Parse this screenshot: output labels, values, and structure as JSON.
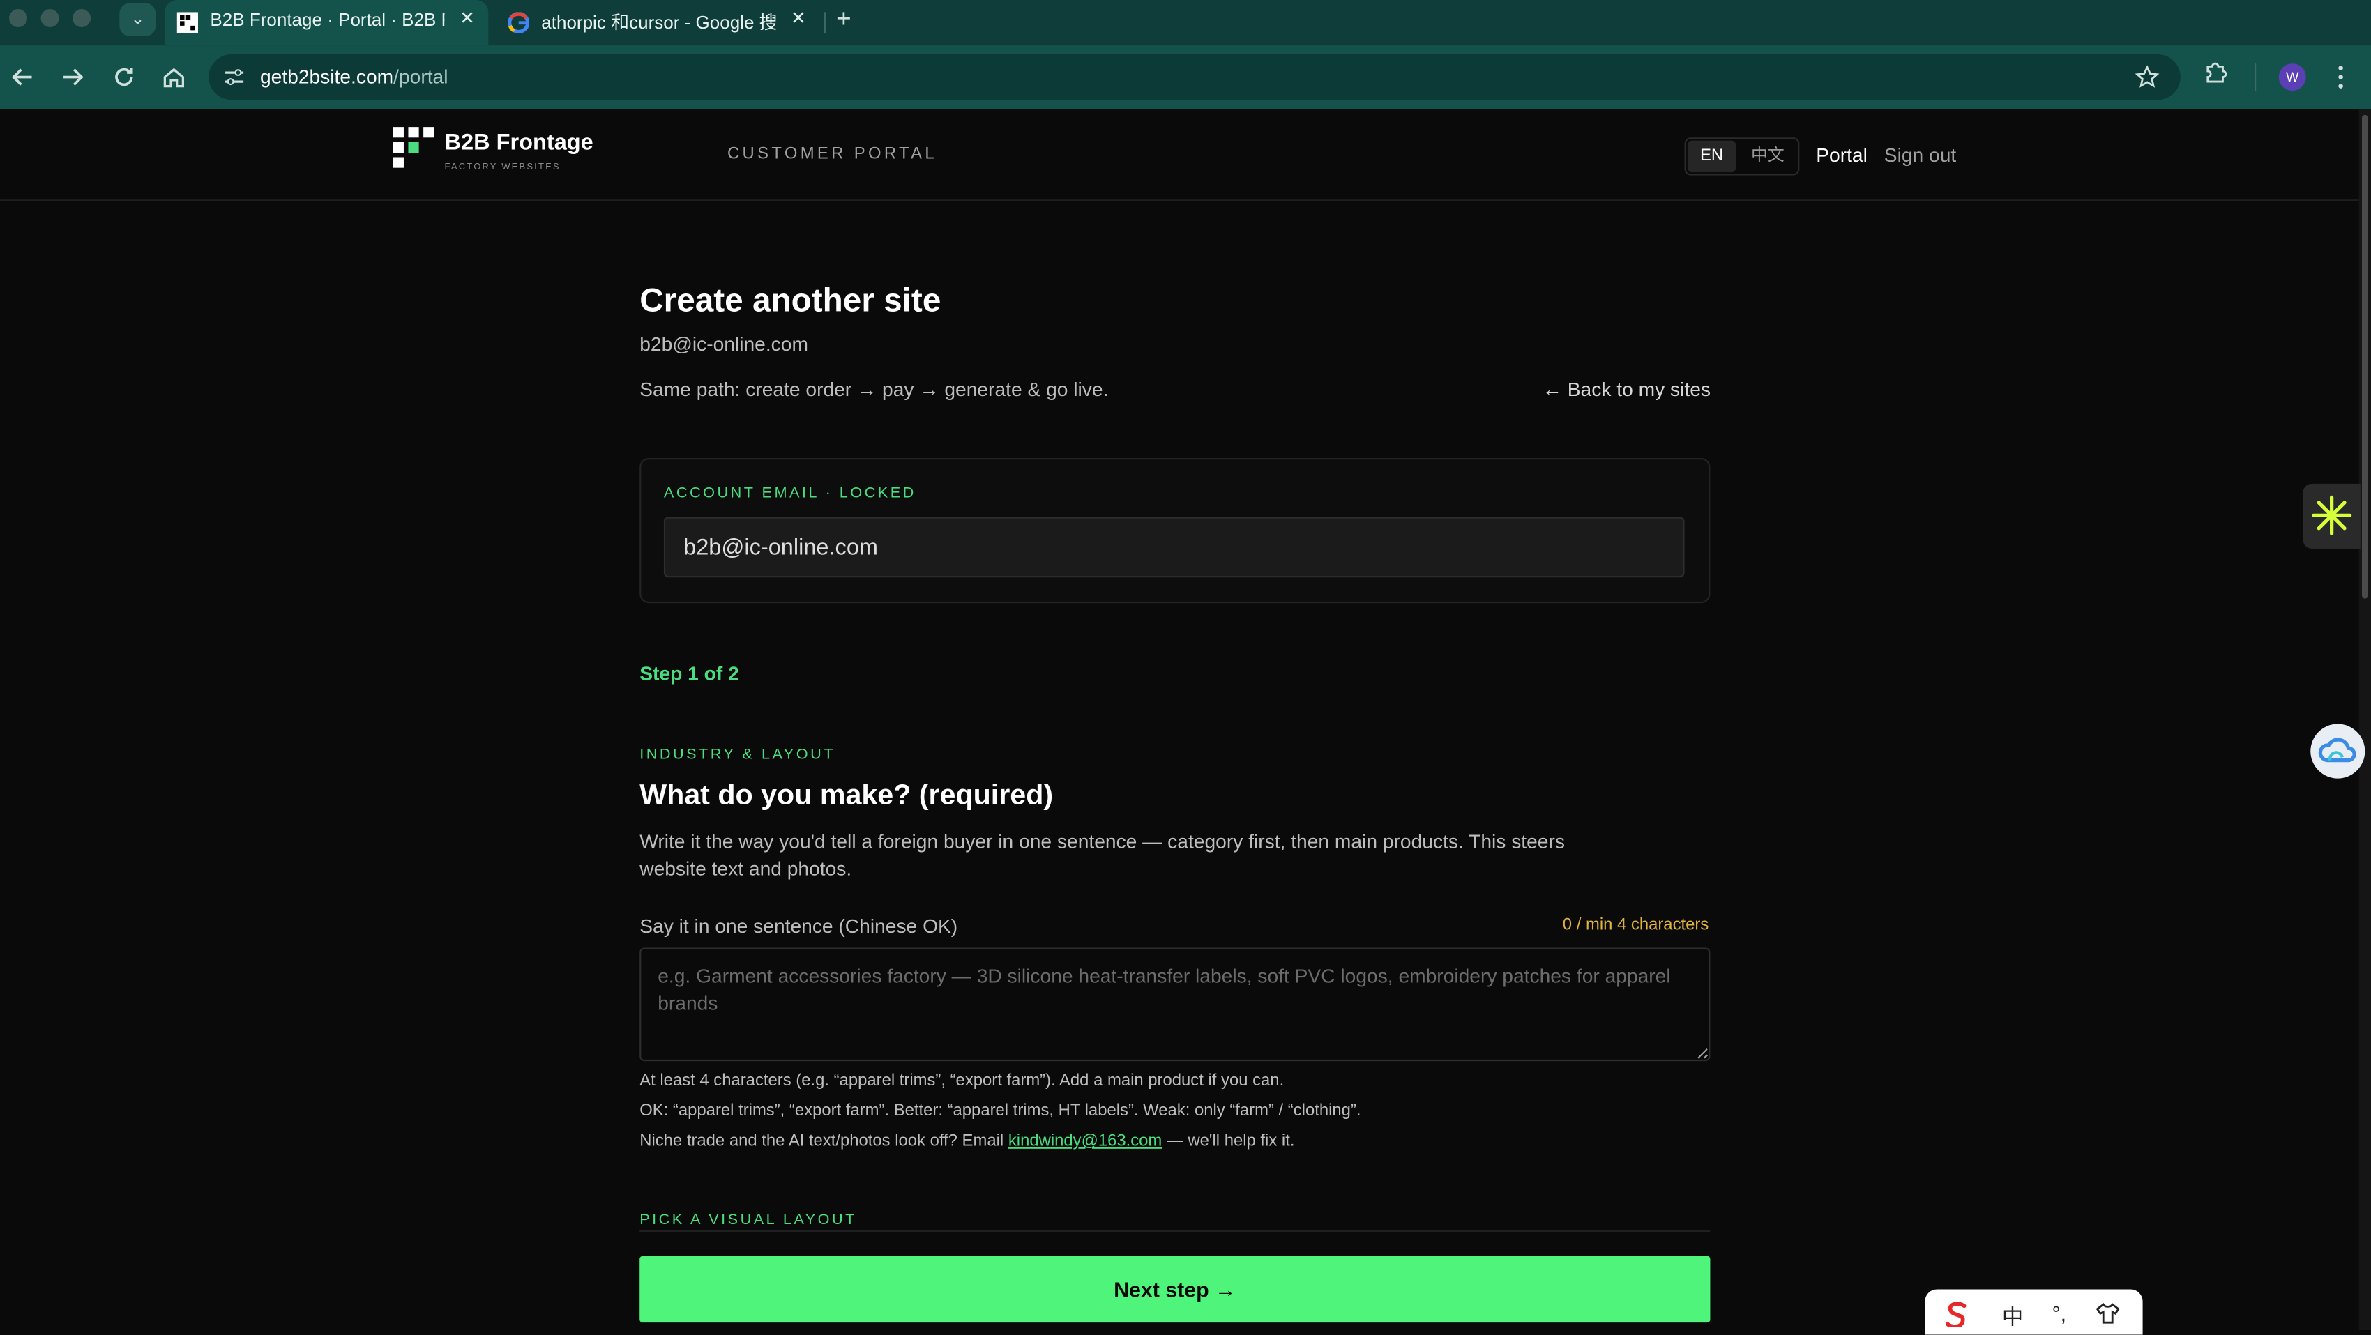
{
  "browser": {
    "tabs": [
      {
        "title": "B2B Frontage · Portal · B2B F",
        "active": true
      },
      {
        "title": "athorpic 和cursor - Google 搜",
        "active": false
      }
    ],
    "close_glyph": "✕",
    "new_tab_glyph": "+",
    "tabs_menu_glyph": "⌄",
    "url_host": "getb2bsite.com",
    "url_path": "/portal",
    "profile_initial": "W",
    "icons": [
      "back-icon",
      "forward-icon",
      "reload-icon",
      "home-icon",
      "site-settings-icon",
      "bookmark-star-icon",
      "extensions-icon",
      "menu-icon"
    ]
  },
  "header": {
    "brand": "B2B Frontage",
    "tagline": "FACTORY WEBSITES",
    "portal_label": "CUSTOMER PORTAL",
    "lang_en": "EN",
    "lang_zh": "中文",
    "nav_portal": "Portal",
    "nav_signout": "Sign out"
  },
  "main": {
    "title": "Create another site",
    "email": "b2b@ic-online.com",
    "path_text": "Same path: create order → pay → generate & go live.",
    "back_link": "← Back to my sites",
    "account_label": "ACCOUNT EMAIL · LOCKED",
    "account_value": "b2b@ic-online.com",
    "step": "Step 1 of 2",
    "section_label": "INDUSTRY & LAYOUT",
    "question": "What do you make? (required)",
    "help": "Write it the way you'd tell a foreign buyer in one sentence — category first, then main products. This steers website text and photos.",
    "field_label": "Say it in one sentence (Chinese OK)",
    "counter": "0 / min 4 characters",
    "textarea_value": "",
    "textarea_placeholder": "e.g. Garment accessories factory — 3D silicone heat-transfer labels, soft PVC logos, embroidery patches for apparel brands",
    "hint1": "At least 4 characters (e.g. “apparel trims”, “export farm”). Add a main product if you can.",
    "hint2": "OK: “apparel trims”, “export farm”. Better: “apparel trims, HT labels”. Weak: only “farm” / “clothing”.",
    "hint3_before": "Niche trade and the AI text/photos look off? Email",
    "hint3_email": "kindwindy@163.com",
    "hint3_after": "— we'll help fix it.",
    "layout_label": "PICK A VISUAL LAYOUT",
    "next_button": "Next step →"
  },
  "ime": {
    "items": [
      "中",
      "°,"
    ]
  },
  "colors": {
    "accent": "#4ade80",
    "button": "#4ff57a",
    "counter": "#e0b341",
    "chrome": "#14524c"
  }
}
